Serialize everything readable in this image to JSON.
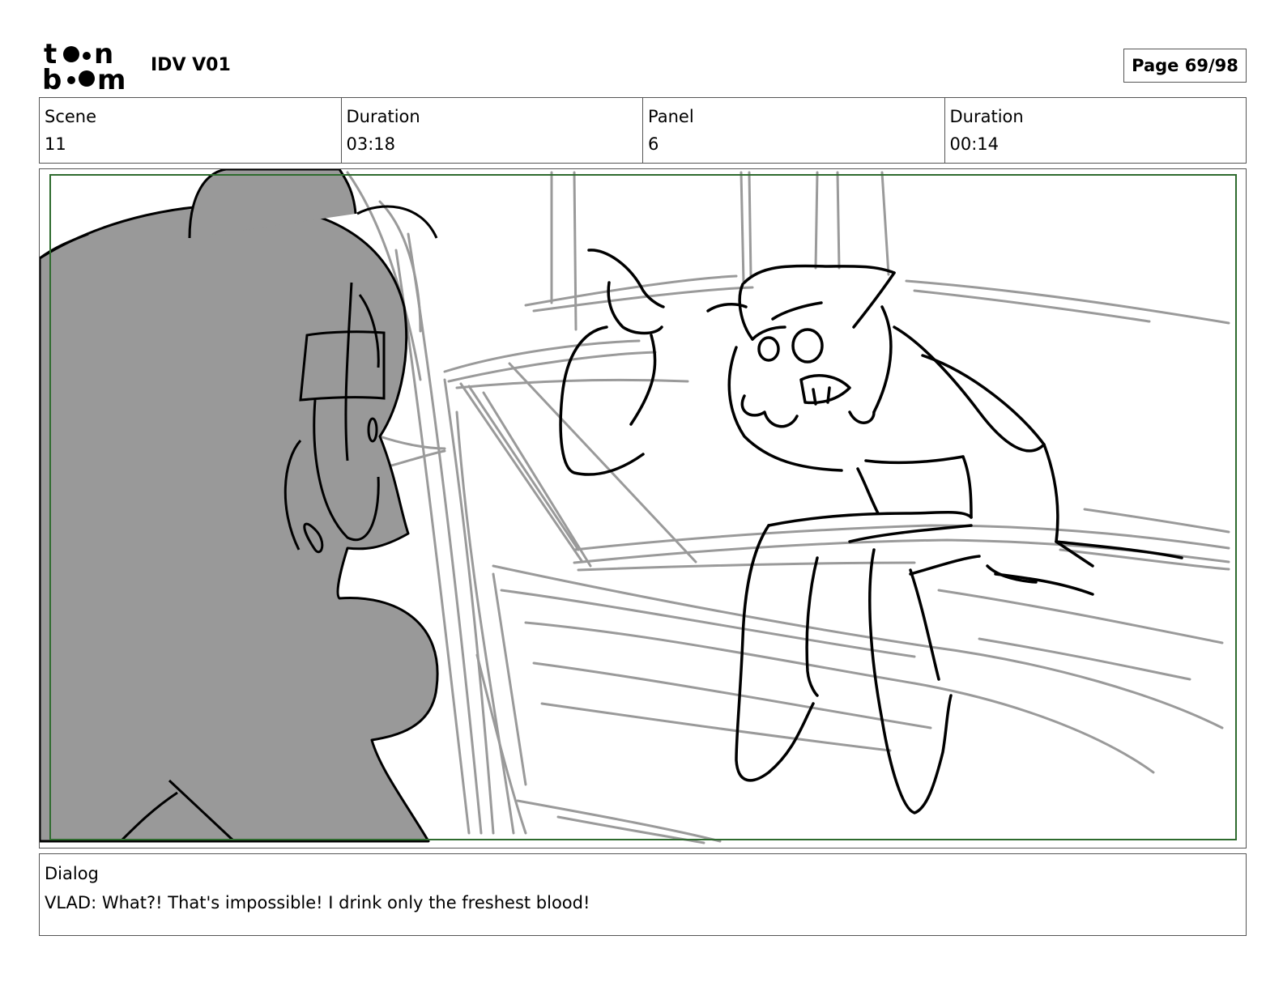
{
  "header": {
    "logo_text": "toon boom",
    "title": "IDV V01",
    "page": "Page 69/98"
  },
  "info": {
    "scene_label": "Scene",
    "scene_value": "11",
    "scene_duration_label": "Duration",
    "scene_duration_value": "03:18",
    "panel_label": "Panel",
    "panel_value": "6",
    "panel_duration_label": "Duration",
    "panel_duration_value": "00:14"
  },
  "dialog": {
    "label": "Dialog",
    "text": "VLAD: What?! That's impossible! I drink only the freshest blood!"
  },
  "colors": {
    "safe_frame": "#2e6b2e",
    "character_fill": "#999999",
    "rough_lines": "#9a9a9a"
  }
}
